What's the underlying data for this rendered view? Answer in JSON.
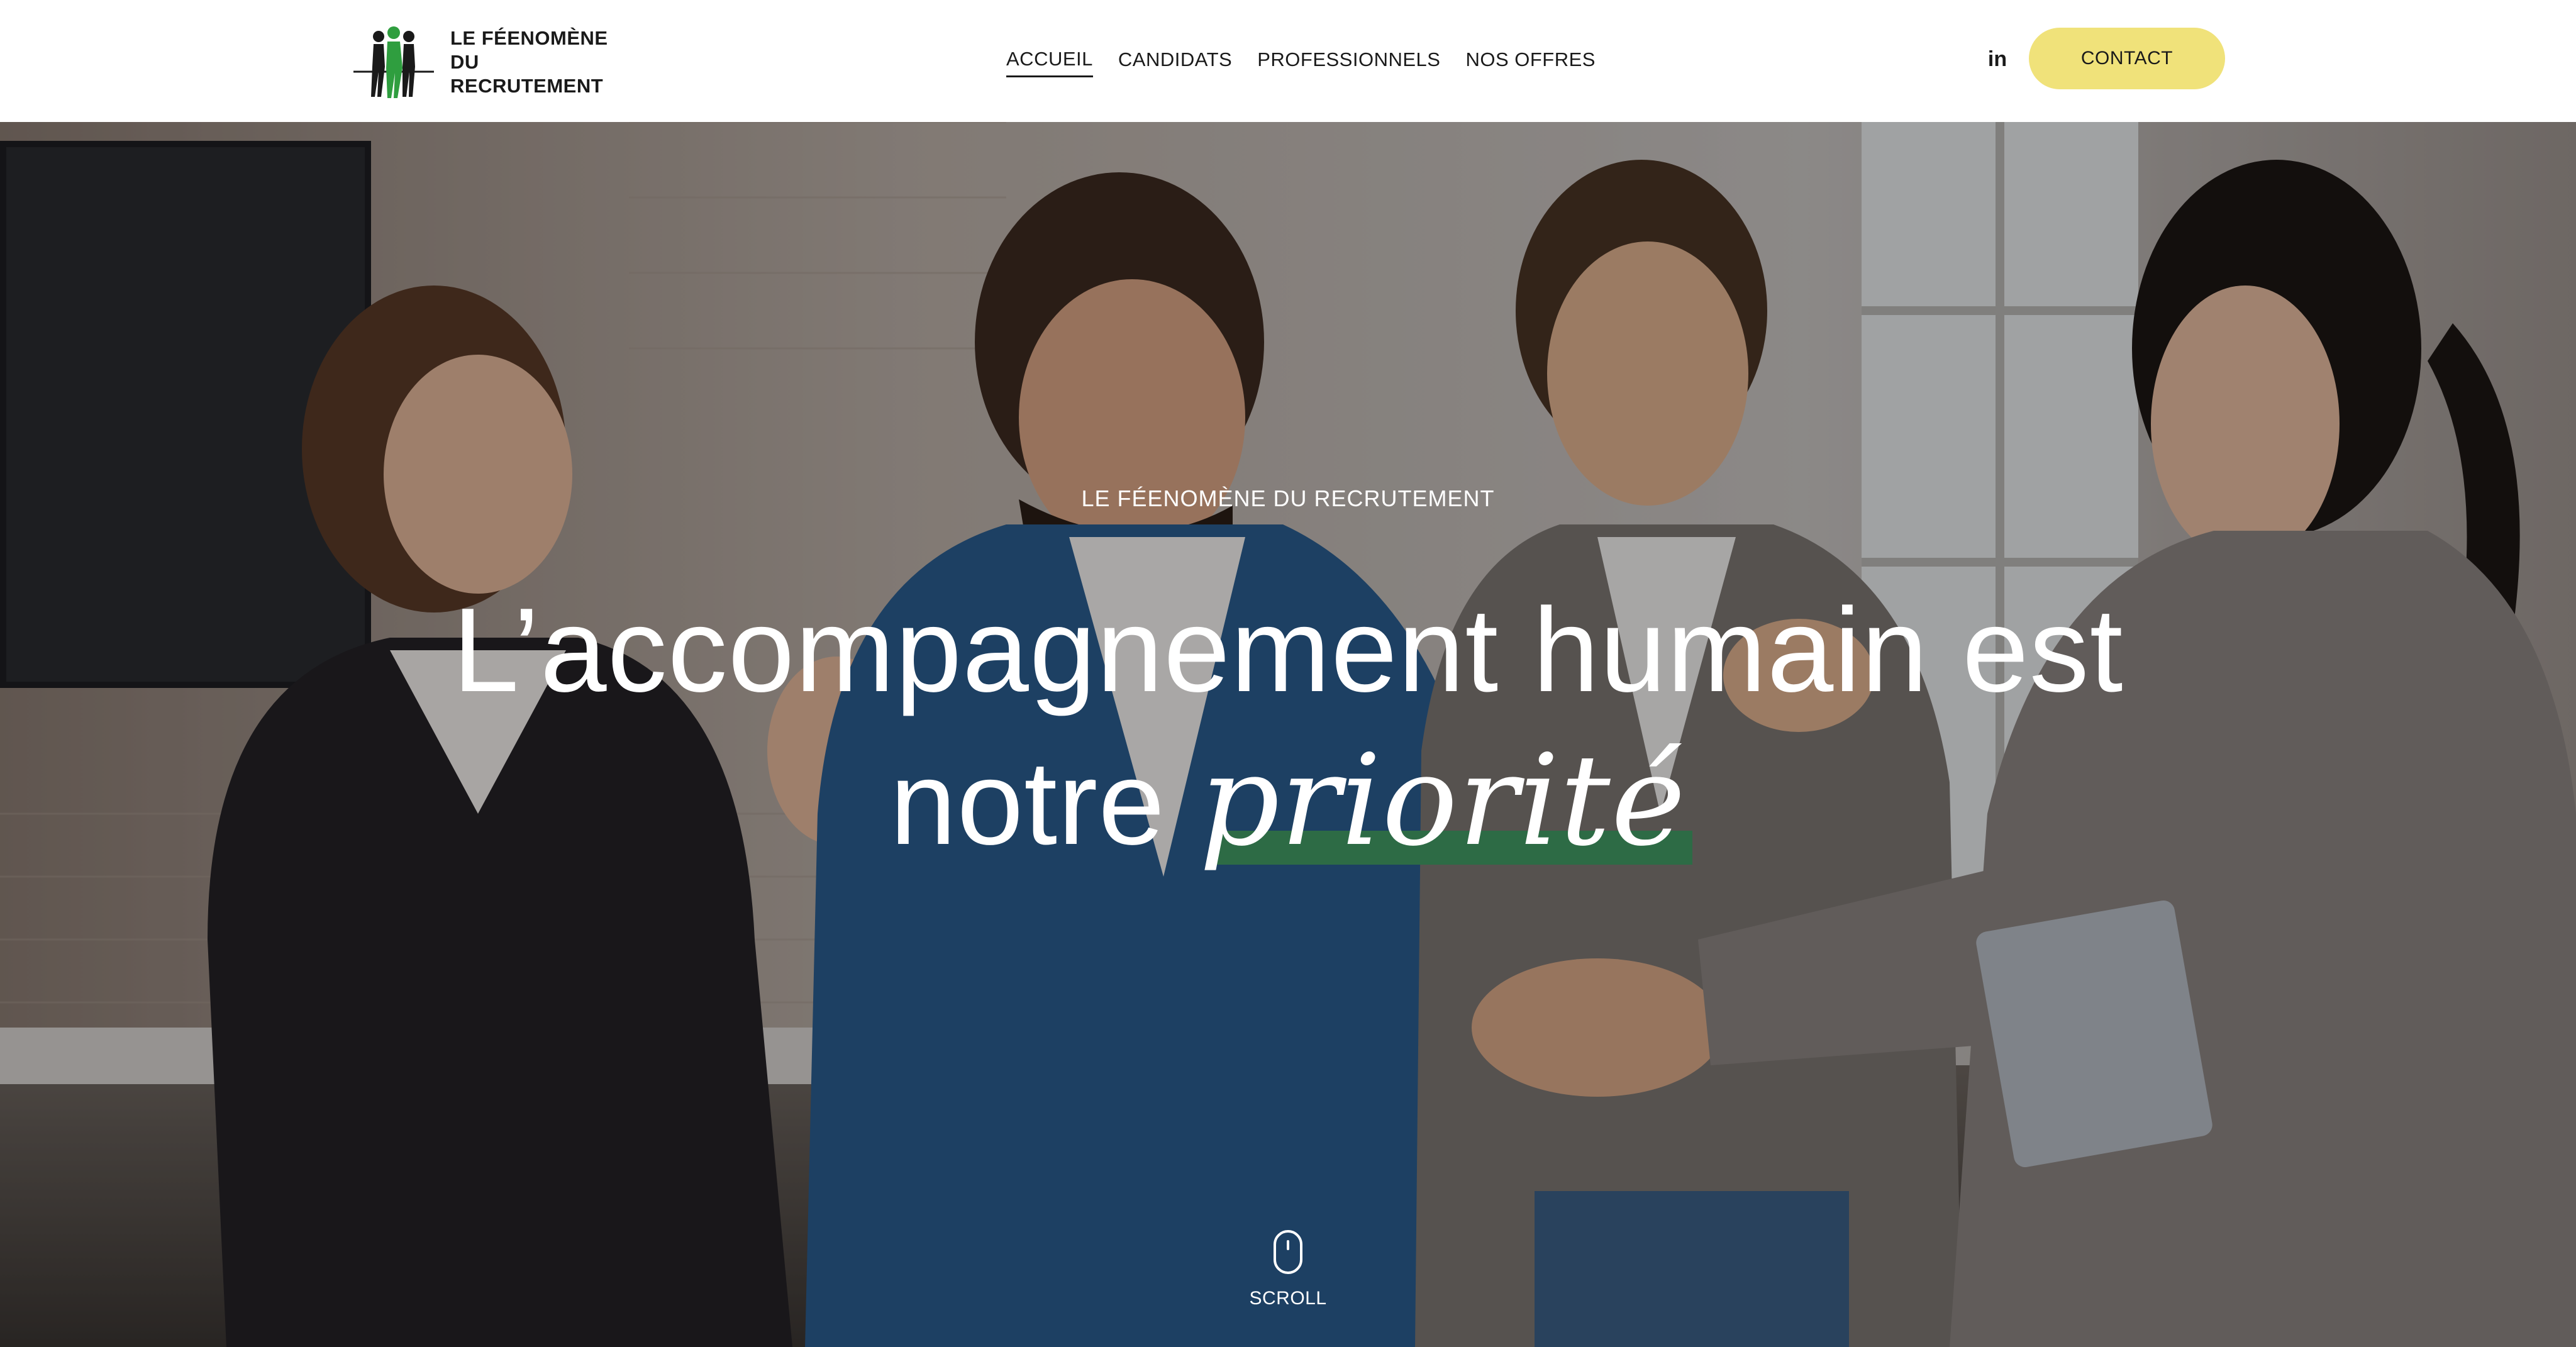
{
  "brand": {
    "name_line1": "LE FÉENOMÈNE",
    "name_line2": "DU RECRUTEMENT",
    "logo_icon": "three-figures-logo-icon",
    "accent_color": "#2d6b45"
  },
  "nav": {
    "items": [
      {
        "label": "ACCUEIL",
        "active": true
      },
      {
        "label": "CANDIDATS",
        "active": false
      },
      {
        "label": "PROFESSIONNELS",
        "active": false
      },
      {
        "label": "NOS OFFRES",
        "active": false
      }
    ]
  },
  "header_actions": {
    "linkedin_label": "in",
    "contact_label": "CONTACT",
    "contact_color": "#f0e27a"
  },
  "hero": {
    "kicker": "LE FÉENOMÈNE DU RECRUTEMENT",
    "title_line1": "L’accompagnement humain est",
    "title_line2_prefix": "notre",
    "title_accent_word": "priorité",
    "background_image": "office-team-handshake-photo",
    "scroll_label": "SCROLL",
    "scroll_icon": "mouse-scroll-icon"
  }
}
